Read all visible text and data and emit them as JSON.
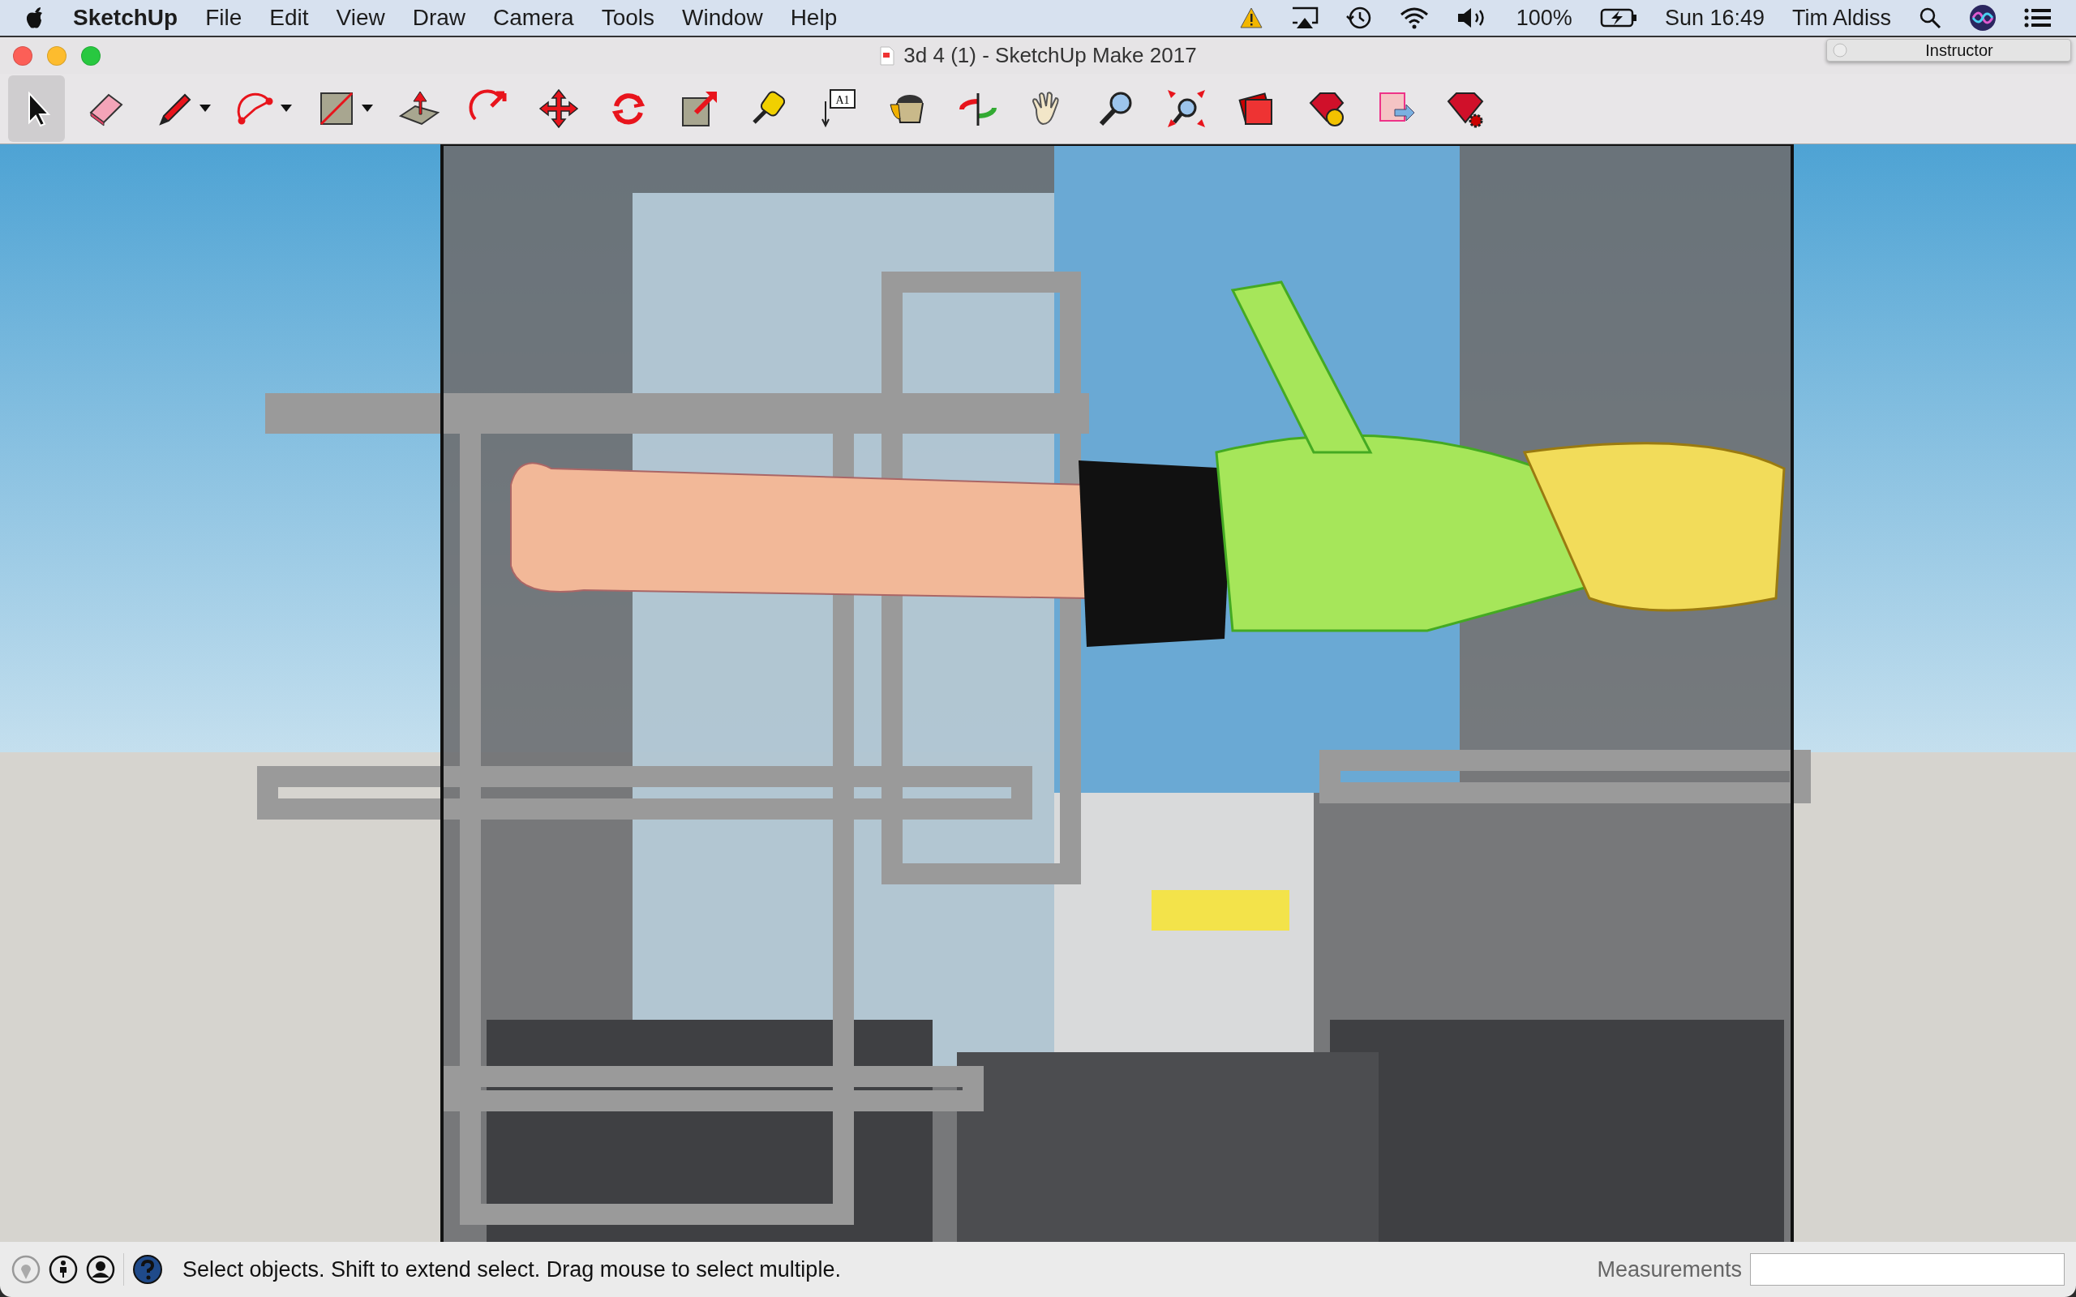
{
  "menu_bar": {
    "app_name": "SketchUp",
    "menus": [
      "File",
      "Edit",
      "View",
      "Draw",
      "Camera",
      "Tools",
      "Window",
      "Help"
    ],
    "status": {
      "battery": "100%",
      "clock": "Sun 16:49",
      "user": "Tim Aldiss"
    }
  },
  "window": {
    "title": "3d 4 (1) - SketchUp Make 2017"
  },
  "instructor": {
    "title": "Instructor"
  },
  "toolbar": [
    {
      "kind": "select",
      "selected": true,
      "dropdown": false
    },
    {
      "kind": "eraser",
      "selected": false,
      "dropdown": false
    },
    {
      "kind": "pencil",
      "selected": false,
      "dropdown": true
    },
    {
      "kind": "arc",
      "selected": false,
      "dropdown": true
    },
    {
      "kind": "rectangle",
      "selected": false,
      "dropdown": true
    },
    {
      "kind": "pushpull",
      "selected": false,
      "dropdown": false
    },
    {
      "kind": "followme",
      "selected": false,
      "dropdown": false
    },
    {
      "kind": "move",
      "selected": false,
      "dropdown": false
    },
    {
      "kind": "rotate",
      "selected": false,
      "dropdown": false
    },
    {
      "kind": "scale",
      "selected": false,
      "dropdown": false
    },
    {
      "kind": "tape",
      "selected": false,
      "dropdown": false
    },
    {
      "kind": "text",
      "selected": false,
      "dropdown": false,
      "label": "A1"
    },
    {
      "kind": "paint",
      "selected": false,
      "dropdown": false
    },
    {
      "kind": "orbit",
      "selected": false,
      "dropdown": false
    },
    {
      "kind": "pan",
      "selected": false,
      "dropdown": false
    },
    {
      "kind": "zoom",
      "selected": false,
      "dropdown": false
    },
    {
      "kind": "extents",
      "selected": false,
      "dropdown": false
    },
    {
      "kind": "layout",
      "selected": false,
      "dropdown": false
    },
    {
      "kind": "ruby",
      "selected": false,
      "dropdown": false
    },
    {
      "kind": "export",
      "selected": false,
      "dropdown": false
    },
    {
      "kind": "rubygear",
      "selected": false,
      "dropdown": false
    }
  ],
  "status_bar": {
    "hint": "Select objects. Shift to extend select. Drag mouse to select multiple.",
    "measurements_label": "Measurements"
  }
}
